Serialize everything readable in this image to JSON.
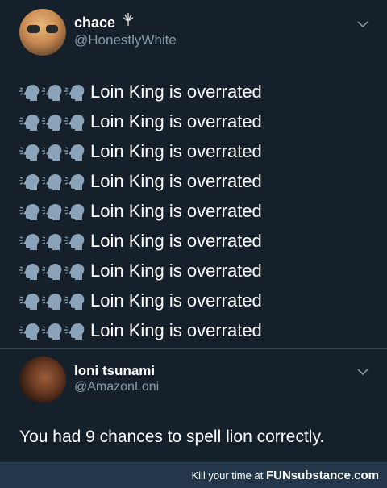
{
  "tweet": {
    "author_name": "chace",
    "author_handle": "@HonestlyWhite",
    "lines": [
      "Loin King is overrated",
      "Loin King is overrated",
      "Loin King is overrated",
      "Loin King is overrated",
      "Loin King is overrated",
      "Loin King is overrated",
      "Loin King is overrated",
      "Loin King is overrated",
      "Loin King is overrated"
    ],
    "line_emoji": "speaking-head-icon",
    "emoji_count_per_line": 3
  },
  "reply": {
    "author_name": "loni tsunami",
    "author_handle": "@AmazonLoni",
    "text": "You had 9 chances to spell lion correctly."
  },
  "footer": {
    "prefix": "Kill your time at",
    "brand": "FUNsubstance.com"
  },
  "colors": {
    "background": "#15202b",
    "secondary_text": "#8899a6",
    "footer_bg": "#23364a"
  }
}
